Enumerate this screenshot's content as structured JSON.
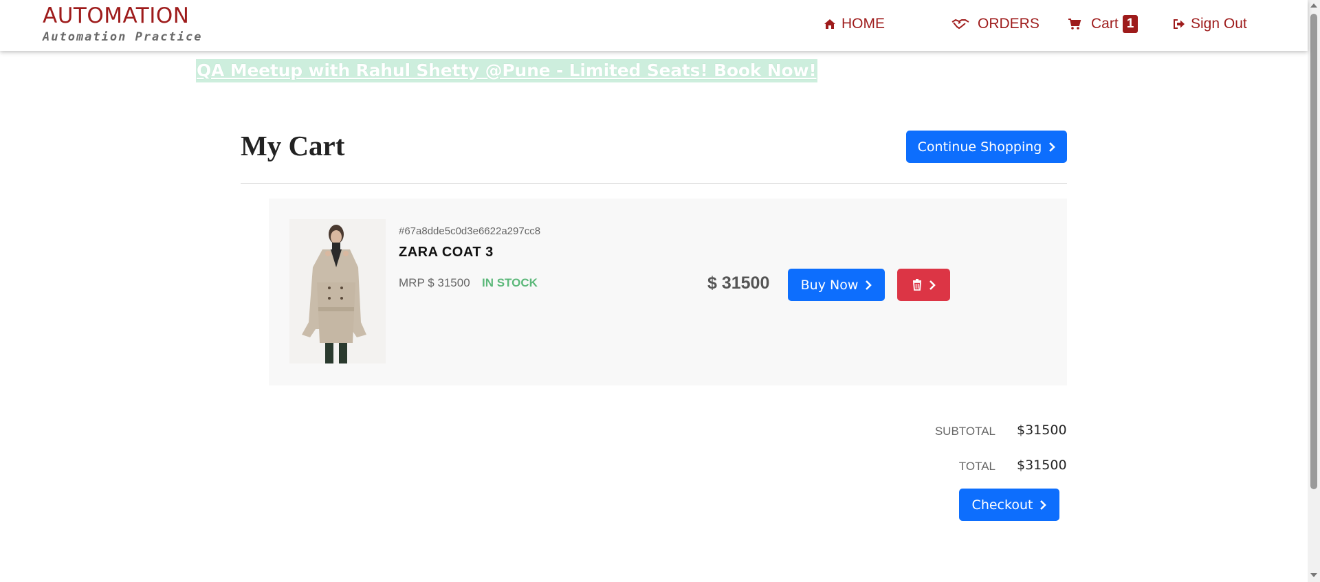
{
  "header": {
    "brand_title": "AUTOMATION",
    "brand_subtitle": "Automation Practice",
    "nav": {
      "home": "HOME",
      "orders": "ORDERS",
      "cart": "Cart",
      "cart_count": "1",
      "signout": "Sign Out"
    },
    "icons": [
      "home-icon",
      "handshake-icon",
      "cart-icon",
      "sign-out-icon"
    ]
  },
  "banner": {
    "text": "QA Meetup with Rahul Shetty @Pune - Limited Seats! Book Now!"
  },
  "page": {
    "title": "My Cart",
    "continue_label": "Continue Shopping"
  },
  "cart_items": [
    {
      "id": "#67a8dde5c0d3e6622a297cc8",
      "name": "ZARA COAT 3",
      "mrp": "MRP $ 31500",
      "stock": "IN STOCK",
      "price": "$ 31500",
      "buy_label": "Buy Now"
    }
  ],
  "summary": {
    "subtotal_label": "SUBTOTAL",
    "subtotal_value": "$31500",
    "total_label": "TOTAL",
    "total_value": "$31500",
    "checkout_label": "Checkout"
  },
  "colors": {
    "brand": "#9e1b1b",
    "primary": "#0d6efd",
    "danger": "#dc3545",
    "stock": "#5cb87a",
    "banner_bg": "#cdeedd"
  }
}
